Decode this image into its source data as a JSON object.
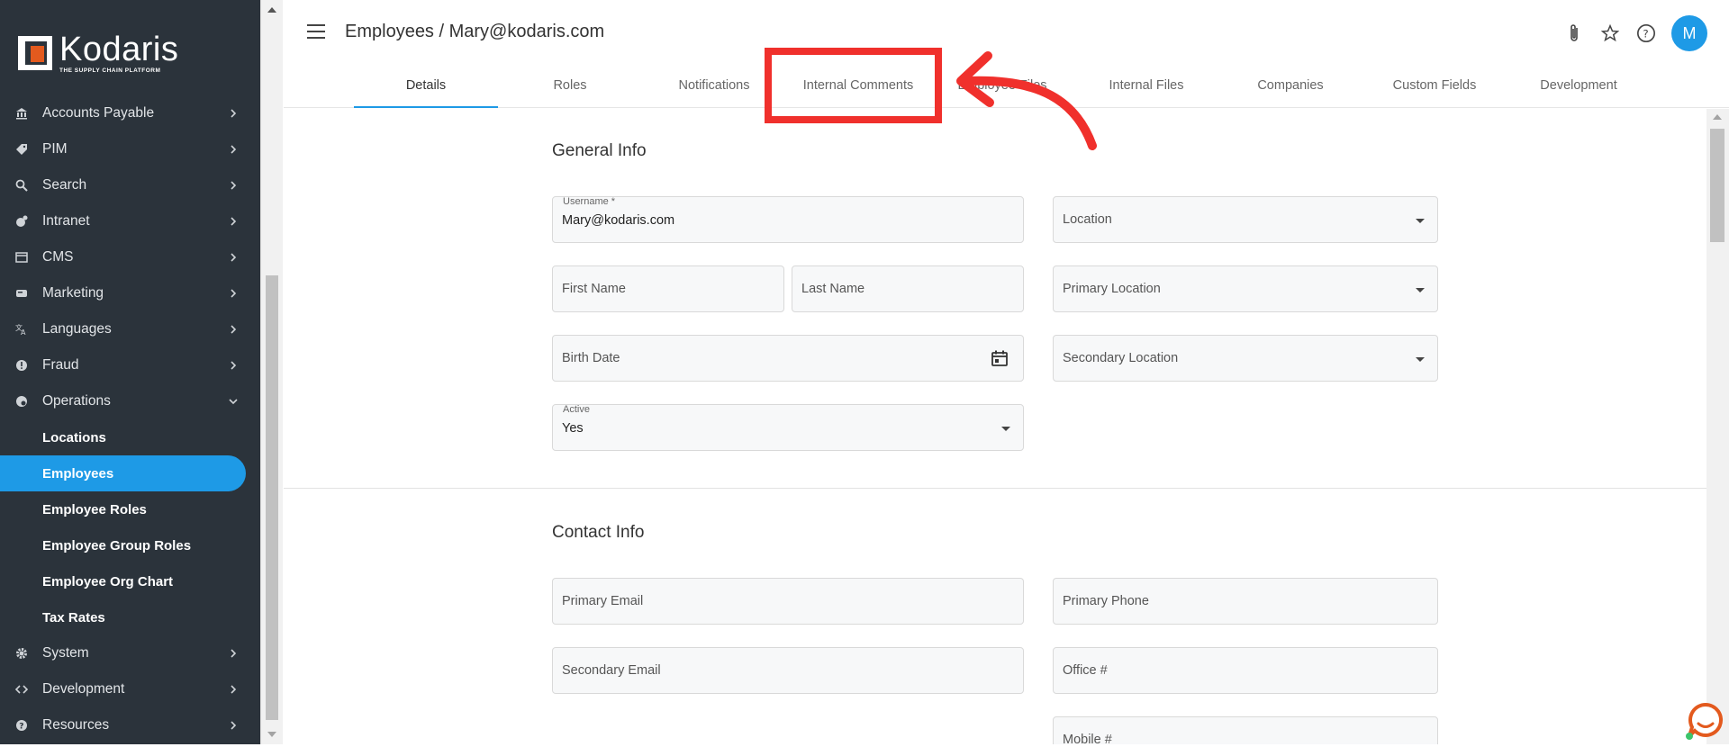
{
  "brand": {
    "name": "Kodaris",
    "tagline": "THE SUPPLY CHAIN PLATFORM",
    "accent": "#1e9ae6",
    "logo_color": "#e35a1e"
  },
  "sidebar": {
    "items": [
      {
        "label": "Accounts Payable",
        "icon": "bank-icon"
      },
      {
        "label": "PIM",
        "icon": "tag-icon"
      },
      {
        "label": "Search",
        "icon": "search-icon"
      },
      {
        "label": "Intranet",
        "icon": "intranet-icon"
      },
      {
        "label": "CMS",
        "icon": "cms-icon"
      },
      {
        "label": "Marketing",
        "icon": "marketing-icon"
      },
      {
        "label": "Languages",
        "icon": "translate-icon"
      },
      {
        "label": "Fraud",
        "icon": "fraud-icon"
      },
      {
        "label": "Operations",
        "icon": "operations-icon",
        "expanded": true
      }
    ],
    "operations_sub": [
      {
        "label": "Locations"
      },
      {
        "label": "Employees",
        "active": true
      },
      {
        "label": "Employee Roles"
      },
      {
        "label": "Employee Group Roles"
      },
      {
        "label": "Employee Org Chart"
      },
      {
        "label": "Tax Rates"
      }
    ],
    "bottom_items": [
      {
        "label": "System",
        "icon": "gear-icon"
      },
      {
        "label": "Development",
        "icon": "code-icon"
      },
      {
        "label": "Resources",
        "icon": "help-icon"
      }
    ]
  },
  "header": {
    "title": "Employees / Mary@kodaris.com",
    "avatar_letter": "M"
  },
  "tabs": [
    {
      "label": "Details",
      "active": true
    },
    {
      "label": "Roles"
    },
    {
      "label": "Notifications"
    },
    {
      "label": "Internal Comments"
    },
    {
      "label": "Employee Files"
    },
    {
      "label": "Internal Files"
    },
    {
      "label": "Companies"
    },
    {
      "label": "Custom Fields"
    },
    {
      "label": "Development"
    }
  ],
  "general_info": {
    "title": "General Info",
    "username_label": "Username *",
    "username_value": "Mary@kodaris.com",
    "location_ph": "Location",
    "first_name_ph": "First Name",
    "last_name_ph": "Last Name",
    "primary_location_ph": "Primary Location",
    "birth_date_ph": "Birth Date",
    "secondary_location_ph": "Secondary Location",
    "active_label": "Active",
    "active_value": "Yes"
  },
  "contact_info": {
    "title": "Contact Info",
    "primary_email_ph": "Primary Email",
    "primary_phone_ph": "Primary Phone",
    "secondary_email_ph": "Secondary Email",
    "office_ph": "Office #",
    "mobile_ph": "Mobile #"
  },
  "annotation_color": "#f0302c"
}
